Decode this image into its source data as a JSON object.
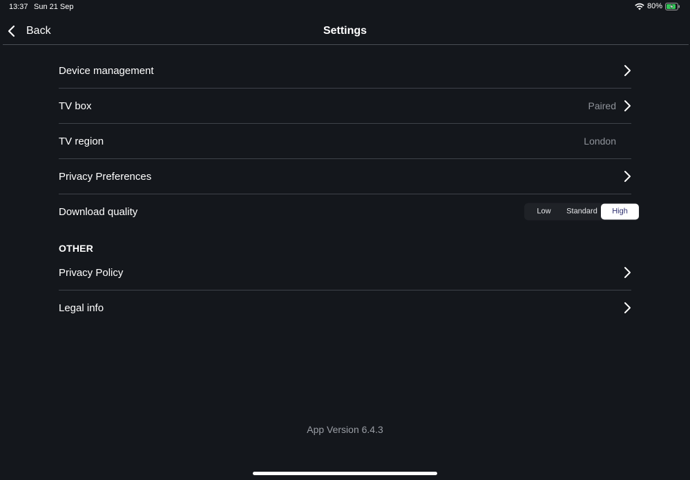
{
  "status_bar": {
    "time": "13:37",
    "date": "Sun 21 Sep",
    "battery_percent": "80%",
    "icons": [
      "wifi-icon",
      "battery-charging-icon"
    ]
  },
  "nav": {
    "back_label": "Back",
    "title": "Settings"
  },
  "settings": {
    "rows": [
      {
        "label": "Device management",
        "value": "",
        "chevron": true
      },
      {
        "label": "TV box",
        "value": "Paired",
        "chevron": true
      },
      {
        "label": "TV region",
        "value": "London",
        "chevron": false
      },
      {
        "label": "Privacy Preferences",
        "value": "",
        "chevron": true
      }
    ],
    "download_quality": {
      "label": "Download quality",
      "options": [
        "Low",
        "Standard",
        "High"
      ],
      "selected": "High"
    }
  },
  "other": {
    "header": "OTHER",
    "rows": [
      {
        "label": "Privacy Policy",
        "chevron": true
      },
      {
        "label": "Legal info",
        "chevron": true
      }
    ]
  },
  "footer": {
    "app_version": "App Version 6.4.3"
  },
  "colors": {
    "background": "#14171c",
    "divider": "#3f434a",
    "secondary_text": "#8f939a",
    "selected_segment_text": "#2c2e6e",
    "battery_charging": "#34c759"
  }
}
